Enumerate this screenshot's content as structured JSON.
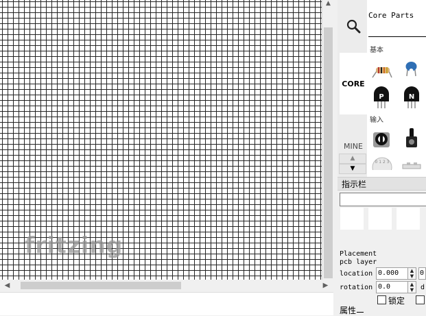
{
  "canvas": {
    "watermark": "fritzing"
  },
  "parts_bin": {
    "title": "Core Parts",
    "tabs": [
      {
        "label": "",
        "icon": "search-icon"
      },
      {
        "label": "CORE"
      },
      {
        "label": "MINE"
      }
    ],
    "sections": [
      {
        "label": "基本"
      },
      {
        "label": "输入"
      }
    ],
    "parts": [
      {
        "icon": "resistor-icon"
      },
      {
        "icon": "ceramic-capacitor-icon"
      },
      {
        "icon": "pnp-transistor-icon",
        "mark": "P"
      },
      {
        "icon": "npn-transistor-icon",
        "mark": "N"
      },
      {
        "icon": "potentiometer-icon"
      },
      {
        "icon": "slide-potentiometer-icon"
      },
      {
        "icon": "rotary-encoder-icon"
      },
      {
        "icon": "dip-switch-icon"
      }
    ]
  },
  "inspector": {
    "title": "指示栏",
    "placement_label": "Placement",
    "pcb_layer_label": "pcb layer",
    "location_label": "location",
    "location_x": "0.000",
    "location_y": "0",
    "rotation_label": "rotation",
    "rotation_value": "0.0",
    "rotation_unit": "d",
    "lock_label": "锁定",
    "properties_label": "属性"
  }
}
